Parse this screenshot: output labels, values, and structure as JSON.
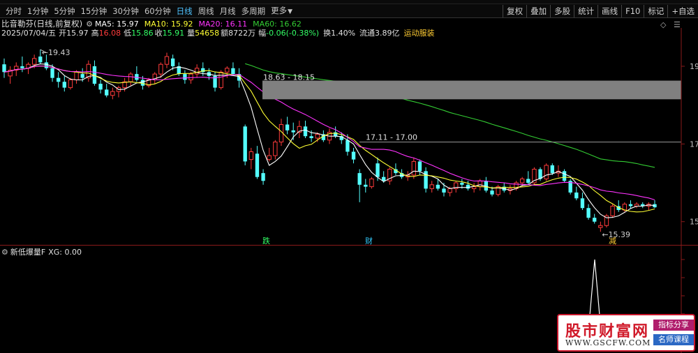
{
  "toolbar": {
    "tabs": [
      "分时",
      "1分钟",
      "5分钟",
      "15分钟",
      "30分钟",
      "60分钟",
      "日线",
      "周线",
      "月线",
      "多周期",
      "更多"
    ],
    "active_tab": "日线",
    "tools": [
      "复权",
      "叠加",
      "多股",
      "统计",
      "画线",
      "F10",
      "标记",
      "+自选"
    ]
  },
  "title": {
    "stock": "比音勒芬(日线,前复权)",
    "ma5": "MA5: 15.97",
    "ma10": "MA10: 15.92",
    "ma20": "MA20: 16.11",
    "ma60": "MA60: 16.62"
  },
  "info": {
    "date": "2025/07/04/五",
    "open_label": "开",
    "open": "15.97",
    "high_label": "高",
    "high": "16.08",
    "low_label": "低",
    "low": "15.86",
    "close_label": "收",
    "close": "15.91",
    "vol_label": "量",
    "vol": "54658",
    "amt_label": "额",
    "amt": "8722万",
    "chg_label": "幅",
    "chg": "-0.06(-0.38%)",
    "turn_label": "换",
    "turn": "1.40%",
    "float_label": "流通",
    "float": "3.89亿",
    "sector": "运动服装"
  },
  "annotations": {
    "high_mark": "19.43",
    "low_mark": "15.39",
    "box1": "18.63 - 18.15",
    "box2": "17.11 - 17.00",
    "mark_die": "跌",
    "mark_cai": "财",
    "mark_jian": "减"
  },
  "price_axis": [
    "19",
    "17",
    "15"
  ],
  "indicator": {
    "label": "新低爆量F",
    "value": "XG: 0.00"
  },
  "logo": {
    "name": "股市财富网",
    "url": "WWW.GSCFW.COM",
    "tag1": "指标分享",
    "tag2": "名师课程"
  },
  "colors": {
    "up": "#ff3b3b",
    "down": "#54ffff",
    "ma5": "#ffffff",
    "ma10": "#ffff33",
    "ma20": "#ff33ff",
    "ma60": "#33cc33",
    "box": "#808080"
  },
  "chart_data": {
    "type": "candlestick",
    "ylim": [
      14.8,
      19.6
    ],
    "candles": [
      {
        "o": 19.05,
        "h": 19.2,
        "l": 18.7,
        "c": 18.85
      },
      {
        "o": 18.75,
        "h": 19.0,
        "l": 18.55,
        "c": 18.9
      },
      {
        "o": 18.9,
        "h": 19.1,
        "l": 18.75,
        "c": 19.0
      },
      {
        "o": 19.0,
        "h": 19.25,
        "l": 18.85,
        "c": 18.95
      },
      {
        "o": 18.95,
        "h": 19.1,
        "l": 18.8,
        "c": 19.05
      },
      {
        "o": 19.05,
        "h": 19.3,
        "l": 18.95,
        "c": 19.2
      },
      {
        "o": 19.25,
        "h": 19.43,
        "l": 19.05,
        "c": 19.1
      },
      {
        "o": 19.1,
        "h": 19.3,
        "l": 18.9,
        "c": 18.95
      },
      {
        "o": 18.95,
        "h": 19.05,
        "l": 18.6,
        "c": 18.7
      },
      {
        "o": 18.7,
        "h": 18.85,
        "l": 18.45,
        "c": 18.6
      },
      {
        "o": 18.6,
        "h": 18.75,
        "l": 18.35,
        "c": 18.45
      },
      {
        "o": 18.45,
        "h": 18.7,
        "l": 18.4,
        "c": 18.65
      },
      {
        "o": 18.65,
        "h": 18.9,
        "l": 18.55,
        "c": 18.85
      },
      {
        "o": 18.8,
        "h": 18.95,
        "l": 18.6,
        "c": 18.7
      },
      {
        "o": 18.7,
        "h": 19.15,
        "l": 18.6,
        "c": 19.05
      },
      {
        "o": 19.0,
        "h": 19.15,
        "l": 18.5,
        "c": 18.55
      },
      {
        "o": 18.55,
        "h": 18.65,
        "l": 18.3,
        "c": 18.4
      },
      {
        "o": 18.4,
        "h": 18.55,
        "l": 18.2,
        "c": 18.25
      },
      {
        "o": 18.25,
        "h": 18.45,
        "l": 18.15,
        "c": 18.35
      },
      {
        "o": 18.35,
        "h": 18.5,
        "l": 18.2,
        "c": 18.45
      },
      {
        "o": 18.45,
        "h": 18.7,
        "l": 18.35,
        "c": 18.6
      },
      {
        "o": 18.6,
        "h": 18.85,
        "l": 18.5,
        "c": 18.8
      },
      {
        "o": 18.8,
        "h": 19.0,
        "l": 18.6,
        "c": 18.65
      },
      {
        "o": 18.65,
        "h": 18.75,
        "l": 18.4,
        "c": 18.5
      },
      {
        "o": 18.5,
        "h": 18.7,
        "l": 18.45,
        "c": 18.65
      },
      {
        "o": 18.65,
        "h": 18.85,
        "l": 18.55,
        "c": 18.8
      },
      {
        "o": 18.8,
        "h": 19.1,
        "l": 18.7,
        "c": 19.05
      },
      {
        "o": 19.05,
        "h": 19.35,
        "l": 18.95,
        "c": 19.25
      },
      {
        "o": 19.2,
        "h": 19.3,
        "l": 18.9,
        "c": 19.0
      },
      {
        "o": 19.0,
        "h": 19.1,
        "l": 18.75,
        "c": 18.8
      },
      {
        "o": 18.8,
        "h": 18.9,
        "l": 18.55,
        "c": 18.65
      },
      {
        "o": 18.65,
        "h": 18.85,
        "l": 18.55,
        "c": 18.8
      },
      {
        "o": 18.8,
        "h": 19.05,
        "l": 18.7,
        "c": 18.95
      },
      {
        "o": 18.95,
        "h": 19.1,
        "l": 18.75,
        "c": 18.85
      },
      {
        "o": 18.85,
        "h": 18.95,
        "l": 18.65,
        "c": 18.75
      },
      {
        "o": 18.75,
        "h": 18.85,
        "l": 18.35,
        "c": 18.45
      },
      {
        "o": 18.45,
        "h": 18.9,
        "l": 18.4,
        "c": 18.85
      },
      {
        "o": 18.85,
        "h": 19.0,
        "l": 18.7,
        "c": 18.95
      },
      {
        "o": 18.95,
        "h": 19.1,
        "l": 18.75,
        "c": 18.8
      },
      {
        "o": 18.8,
        "h": 18.95,
        "l": 18.45,
        "c": 18.63
      },
      {
        "o": 17.45,
        "h": 17.5,
        "l": 16.45,
        "c": 16.55
      },
      {
        "o": 16.6,
        "h": 16.9,
        "l": 16.35,
        "c": 16.8
      },
      {
        "o": 16.75,
        "h": 16.95,
        "l": 16.1,
        "c": 16.15
      },
      {
        "o": 16.25,
        "h": 16.35,
        "l": 15.95,
        "c": 16.05
      },
      {
        "o": 16.6,
        "h": 16.9,
        "l": 16.55,
        "c": 16.7
      },
      {
        "o": 16.7,
        "h": 17.1,
        "l": 16.6,
        "c": 17.05
      },
      {
        "o": 17.05,
        "h": 17.65,
        "l": 16.95,
        "c": 17.5
      },
      {
        "o": 17.5,
        "h": 17.7,
        "l": 17.25,
        "c": 17.35
      },
      {
        "o": 17.35,
        "h": 17.55,
        "l": 17.1,
        "c": 17.3
      },
      {
        "o": 17.3,
        "h": 17.6,
        "l": 17.15,
        "c": 17.45
      },
      {
        "o": 17.45,
        "h": 17.6,
        "l": 17.15,
        "c": 17.2
      },
      {
        "o": 17.2,
        "h": 17.35,
        "l": 17.05,
        "c": 17.15
      },
      {
        "o": 17.15,
        "h": 17.3,
        "l": 17.05,
        "c": 17.25
      },
      {
        "o": 17.25,
        "h": 17.35,
        "l": 17.05,
        "c": 17.1
      },
      {
        "o": 17.1,
        "h": 17.4,
        "l": 17.0,
        "c": 17.3
      },
      {
        "o": 17.3,
        "h": 17.45,
        "l": 17.15,
        "c": 17.2
      },
      {
        "o": 17.2,
        "h": 17.3,
        "l": 17.0,
        "c": 17.1
      },
      {
        "o": 17.1,
        "h": 17.25,
        "l": 16.7,
        "c": 16.8
      },
      {
        "o": 16.8,
        "h": 16.9,
        "l": 16.5,
        "c": 16.6
      },
      {
        "o": 16.25,
        "h": 16.35,
        "l": 15.5,
        "c": 15.95
      },
      {
        "o": 15.95,
        "h": 16.1,
        "l": 15.75,
        "c": 15.9
      },
      {
        "o": 15.9,
        "h": 16.15,
        "l": 15.85,
        "c": 16.1
      },
      {
        "o": 16.5,
        "h": 16.65,
        "l": 16.05,
        "c": 16.15
      },
      {
        "o": 16.15,
        "h": 16.3,
        "l": 16.0,
        "c": 16.05
      },
      {
        "o": 16.05,
        "h": 16.4,
        "l": 15.95,
        "c": 16.35
      },
      {
        "o": 16.35,
        "h": 16.5,
        "l": 16.2,
        "c": 16.25
      },
      {
        "o": 16.25,
        "h": 16.35,
        "l": 16.1,
        "c": 16.15
      },
      {
        "o": 16.15,
        "h": 16.3,
        "l": 16.05,
        "c": 16.2
      },
      {
        "o": 16.2,
        "h": 16.65,
        "l": 16.1,
        "c": 16.55
      },
      {
        "o": 16.55,
        "h": 16.6,
        "l": 16.2,
        "c": 16.3
      },
      {
        "o": 16.3,
        "h": 16.4,
        "l": 15.75,
        "c": 15.85
      },
      {
        "o": 15.85,
        "h": 16.05,
        "l": 15.75,
        "c": 15.95
      },
      {
        "o": 15.95,
        "h": 16.1,
        "l": 15.8,
        "c": 15.85
      },
      {
        "o": 15.85,
        "h": 16.0,
        "l": 15.65,
        "c": 15.75
      },
      {
        "o": 15.75,
        "h": 15.9,
        "l": 15.65,
        "c": 15.85
      },
      {
        "o": 15.85,
        "h": 16.05,
        "l": 15.75,
        "c": 16.0
      },
      {
        "o": 16.0,
        "h": 16.1,
        "l": 15.85,
        "c": 15.95
      },
      {
        "o": 15.95,
        "h": 16.05,
        "l": 15.8,
        "c": 15.85
      },
      {
        "o": 15.85,
        "h": 16.0,
        "l": 15.75,
        "c": 15.9
      },
      {
        "o": 15.9,
        "h": 16.1,
        "l": 15.8,
        "c": 16.05
      },
      {
        "o": 16.05,
        "h": 16.15,
        "l": 15.75,
        "c": 15.8
      },
      {
        "o": 15.8,
        "h": 15.9,
        "l": 15.65,
        "c": 15.7
      },
      {
        "o": 15.7,
        "h": 15.95,
        "l": 15.65,
        "c": 15.9
      },
      {
        "o": 15.9,
        "h": 16.0,
        "l": 15.75,
        "c": 15.8
      },
      {
        "o": 15.8,
        "h": 15.95,
        "l": 15.7,
        "c": 15.85
      },
      {
        "o": 15.85,
        "h": 16.05,
        "l": 15.8,
        "c": 16.0
      },
      {
        "o": 16.0,
        "h": 16.15,
        "l": 15.9,
        "c": 16.1
      },
      {
        "o": 16.1,
        "h": 16.3,
        "l": 15.95,
        "c": 16.0
      },
      {
        "o": 16.0,
        "h": 16.4,
        "l": 15.95,
        "c": 16.35
      },
      {
        "o": 16.35,
        "h": 16.4,
        "l": 16.05,
        "c": 16.1
      },
      {
        "o": 16.1,
        "h": 16.5,
        "l": 16.05,
        "c": 16.45
      },
      {
        "o": 16.45,
        "h": 16.5,
        "l": 16.2,
        "c": 16.25
      },
      {
        "o": 16.25,
        "h": 16.45,
        "l": 16.15,
        "c": 16.3
      },
      {
        "o": 16.3,
        "h": 16.35,
        "l": 16.0,
        "c": 16.05
      },
      {
        "o": 16.05,
        "h": 16.1,
        "l": 15.7,
        "c": 15.75
      },
      {
        "o": 15.75,
        "h": 15.9,
        "l": 15.55,
        "c": 15.6
      },
      {
        "o": 15.6,
        "h": 15.75,
        "l": 15.3,
        "c": 15.35
      },
      {
        "o": 15.35,
        "h": 15.45,
        "l": 15.05,
        "c": 15.1
      },
      {
        "o": 15.1,
        "h": 15.2,
        "l": 14.95,
        "c": 15.0
      },
      {
        "o": 14.85,
        "h": 15.0,
        "l": 14.74,
        "c": 14.9
      },
      {
        "o": 14.9,
        "h": 15.2,
        "l": 14.85,
        "c": 15.15
      },
      {
        "o": 15.15,
        "h": 15.45,
        "l": 15.1,
        "c": 15.4
      },
      {
        "o": 15.4,
        "h": 15.55,
        "l": 15.25,
        "c": 15.3
      },
      {
        "o": 15.3,
        "h": 15.5,
        "l": 15.25,
        "c": 15.45
      },
      {
        "o": 15.45,
        "h": 15.55,
        "l": 15.35,
        "c": 15.4
      },
      {
        "o": 15.4,
        "h": 15.5,
        "l": 15.35,
        "c": 15.45
      },
      {
        "o": 15.45,
        "h": 15.5,
        "l": 15.35,
        "c": 15.4
      },
      {
        "o": 15.4,
        "h": 15.5,
        "l": 15.3,
        "c": 15.45
      },
      {
        "o": 15.45,
        "h": 15.55,
        "l": 15.35,
        "c": 15.37
      }
    ]
  }
}
